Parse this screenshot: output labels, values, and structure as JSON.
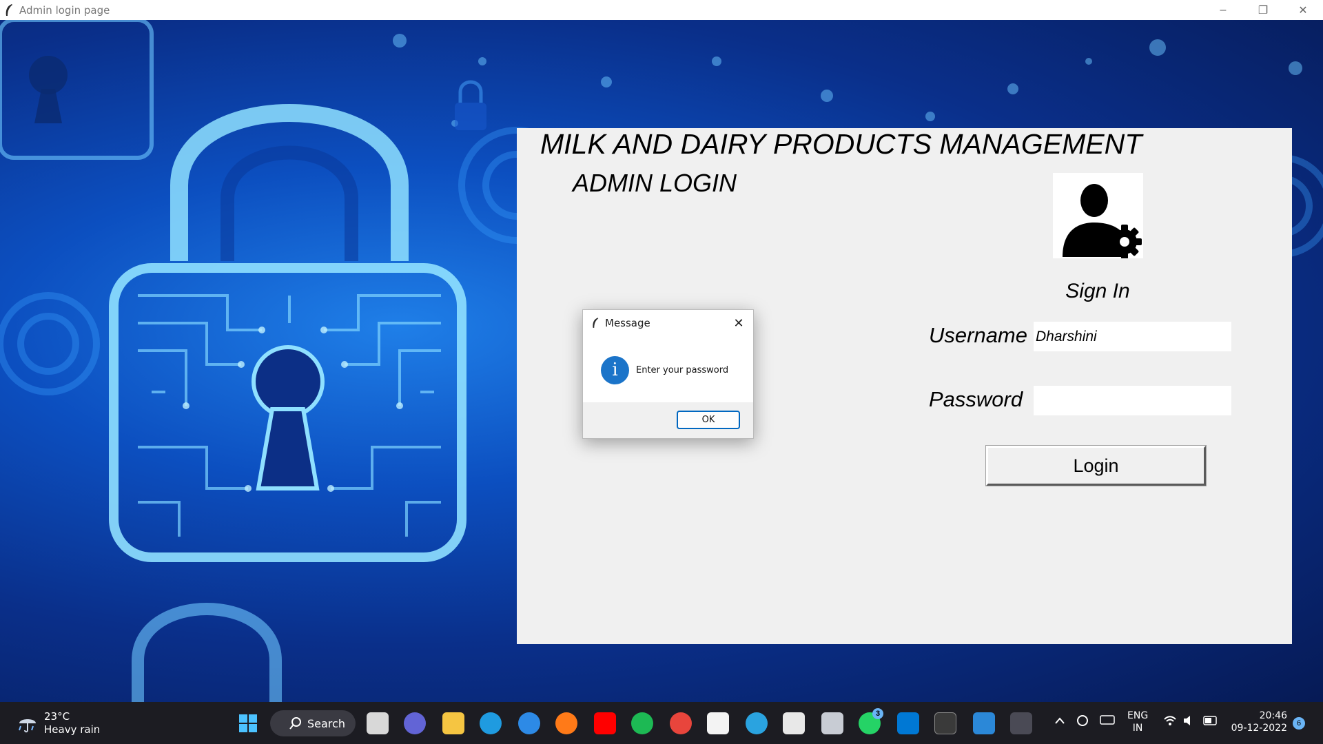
{
  "window": {
    "title": "Admin login page",
    "controls": {
      "minimize": "–",
      "restore": "❐",
      "close": "✕"
    }
  },
  "app": {
    "title": "MILK AND DAIRY PRODUCTS MANAGEMENT",
    "subtitle": "ADMIN LOGIN",
    "avatar_icon": "admin-user-gear-icon",
    "sign_in_label": "Sign In",
    "username_label": "Username",
    "username_value": "Dharshini",
    "password_label": "Password",
    "password_value": "",
    "login_button": "Login"
  },
  "dialog": {
    "title": "Message",
    "close_glyph": "✕",
    "icon": "info-icon",
    "icon_glyph": "i",
    "message": "Enter your password",
    "ok_label": "OK"
  },
  "taskbar": {
    "weather_temp": "23°C",
    "weather_desc": "Heavy rain",
    "search_label": "Search",
    "whatsapp_badge": "3",
    "lang_top": "ENG",
    "lang_bottom": "IN",
    "time": "20:46",
    "date": "09-12-2022",
    "notification_count": "6"
  },
  "colors": {
    "panel_bg": "#f0f0f0",
    "info_blue": "#1b74c9",
    "ok_border": "#0067c0",
    "taskbar_bg": "#1c1c22"
  }
}
